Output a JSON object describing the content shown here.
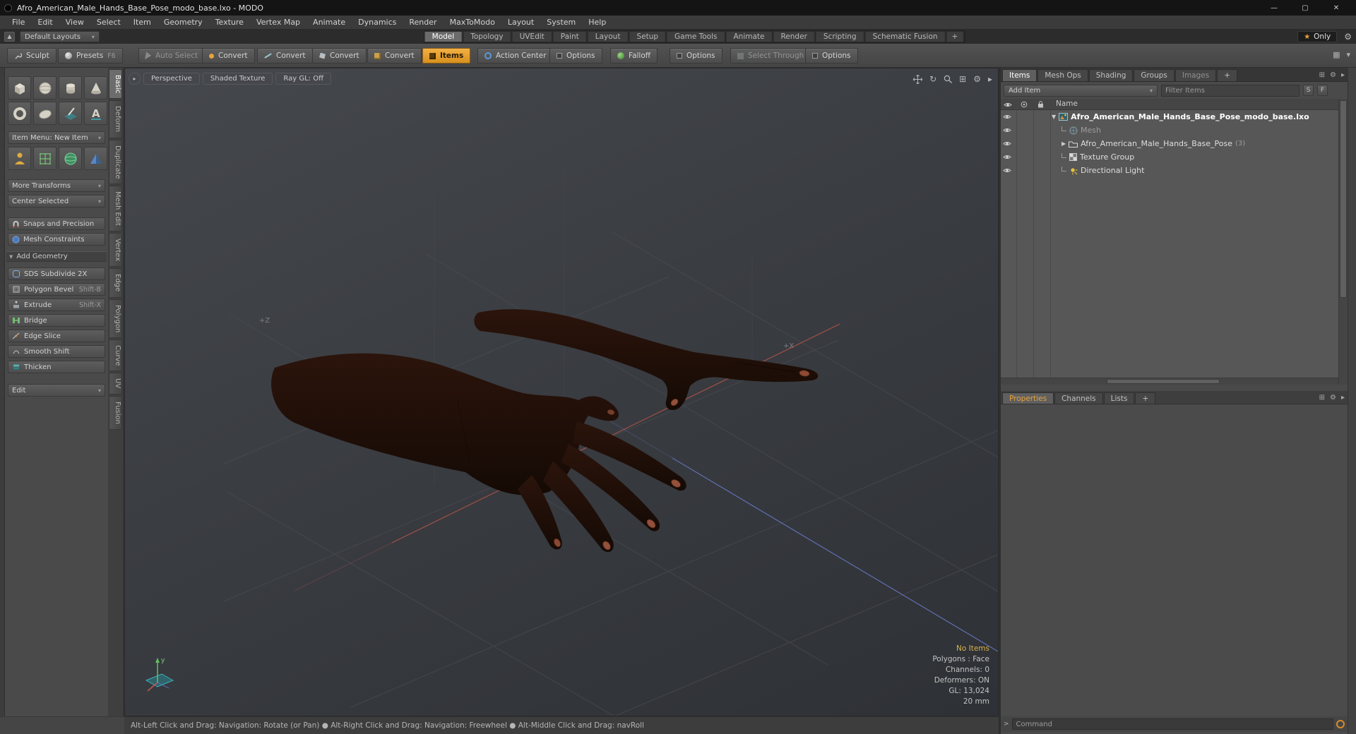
{
  "window": {
    "title": "Afro_American_Male_Hands_Base_Pose_modo_base.lxo - MODO",
    "minimize": "—",
    "maximize": "▢",
    "close": "✕"
  },
  "menu_bar": {
    "items": [
      "File",
      "Edit",
      "View",
      "Select",
      "Item",
      "Geometry",
      "Texture",
      "Vertex Map",
      "Animate",
      "Dynamics",
      "Render",
      "MaxToModo",
      "Layout",
      "System",
      "Help"
    ]
  },
  "layout_bar": {
    "preset": "Default Layouts",
    "tabs": [
      "Model",
      "Topology",
      "UVEdit",
      "Paint",
      "Layout",
      "Setup",
      "Game Tools",
      "Animate",
      "Render",
      "Scripting",
      "Schematic Fusion",
      "+"
    ],
    "star": "★",
    "only": "Only"
  },
  "toolbar": {
    "sculpt": "Sculpt",
    "presets": "Presets",
    "presets_key": "F6",
    "auto_select": "Auto Select",
    "convert_vertices": "Convert",
    "convert_edges": "Convert",
    "convert_polygons": "Convert",
    "convert_items": "Convert",
    "items": "Items",
    "action_center": "Action Center",
    "options_a": "Options",
    "falloff": "Falloff",
    "options_b": "Options",
    "select_through": "Select Through",
    "options_c": "Options"
  },
  "left_panel": {
    "item_menu": "Item Menu: New Item",
    "more_transforms": "More Transforms",
    "center_selected": "Center Selected",
    "snaps": "Snaps and Precision",
    "mesh_constraints": "Mesh Constraints",
    "add_geometry": "Add Geometry",
    "tools": [
      {
        "label": "SDS Subdivide 2X",
        "key": ""
      },
      {
        "label": "Polygon Bevel",
        "key": "Shift-B"
      },
      {
        "label": "Extrude",
        "key": "Shift-X"
      },
      {
        "label": "Bridge",
        "key": ""
      },
      {
        "label": "Edge Slice",
        "key": ""
      },
      {
        "label": "Smooth Shift",
        "key": ""
      },
      {
        "label": "Thicken",
        "key": ""
      }
    ],
    "edit": "Edit"
  },
  "side_tabs": {
    "tabs": [
      "Basic",
      "Deform",
      "Duplicate",
      "Mesh Edit",
      "Vertex",
      "Edge",
      "Polygon",
      "Curve",
      "UV",
      "Fusion"
    ]
  },
  "viewport": {
    "perspective": "Perspective",
    "shading": "Shaded Texture",
    "raygl": "Ray GL: Off",
    "axis_z": "+Z",
    "axis_x": "+X",
    "gizmo_y": "y",
    "stats": {
      "selection": "No Items",
      "polygons": "Polygons : Face",
      "channels": "Channels: 0",
      "deformers": "Deformers: ON",
      "gl": "GL: 13,024",
      "grid": "20 mm"
    }
  },
  "right_panel": {
    "tabs": [
      "Items",
      "Mesh Ops",
      "Shading",
      "Groups",
      "Images",
      "+"
    ],
    "add_item": "Add Item",
    "filter": "Filter Items",
    "btn_s": "S",
    "btn_f": "F",
    "name_header": "Name",
    "tree": {
      "root": "Afro_American_Male_Hands_Base_Pose_modo_base.lxo",
      "mesh": "Mesh",
      "group": "Afro_American_Male_Hands_Base_Pose",
      "group_count": "(3)",
      "texture": "Texture Group",
      "light": "Directional Light"
    },
    "bottom_tabs": [
      "Properties",
      "Channels",
      "Lists",
      "+"
    ],
    "command": "Command"
  },
  "status_bar": {
    "text": "Alt-Left Click and Drag: Navigation: Rotate (or Pan)    ●    Alt-Right Click and Drag: Navigation: Freewheel    ●    Alt-Middle Click and Drag: navRoll"
  }
}
